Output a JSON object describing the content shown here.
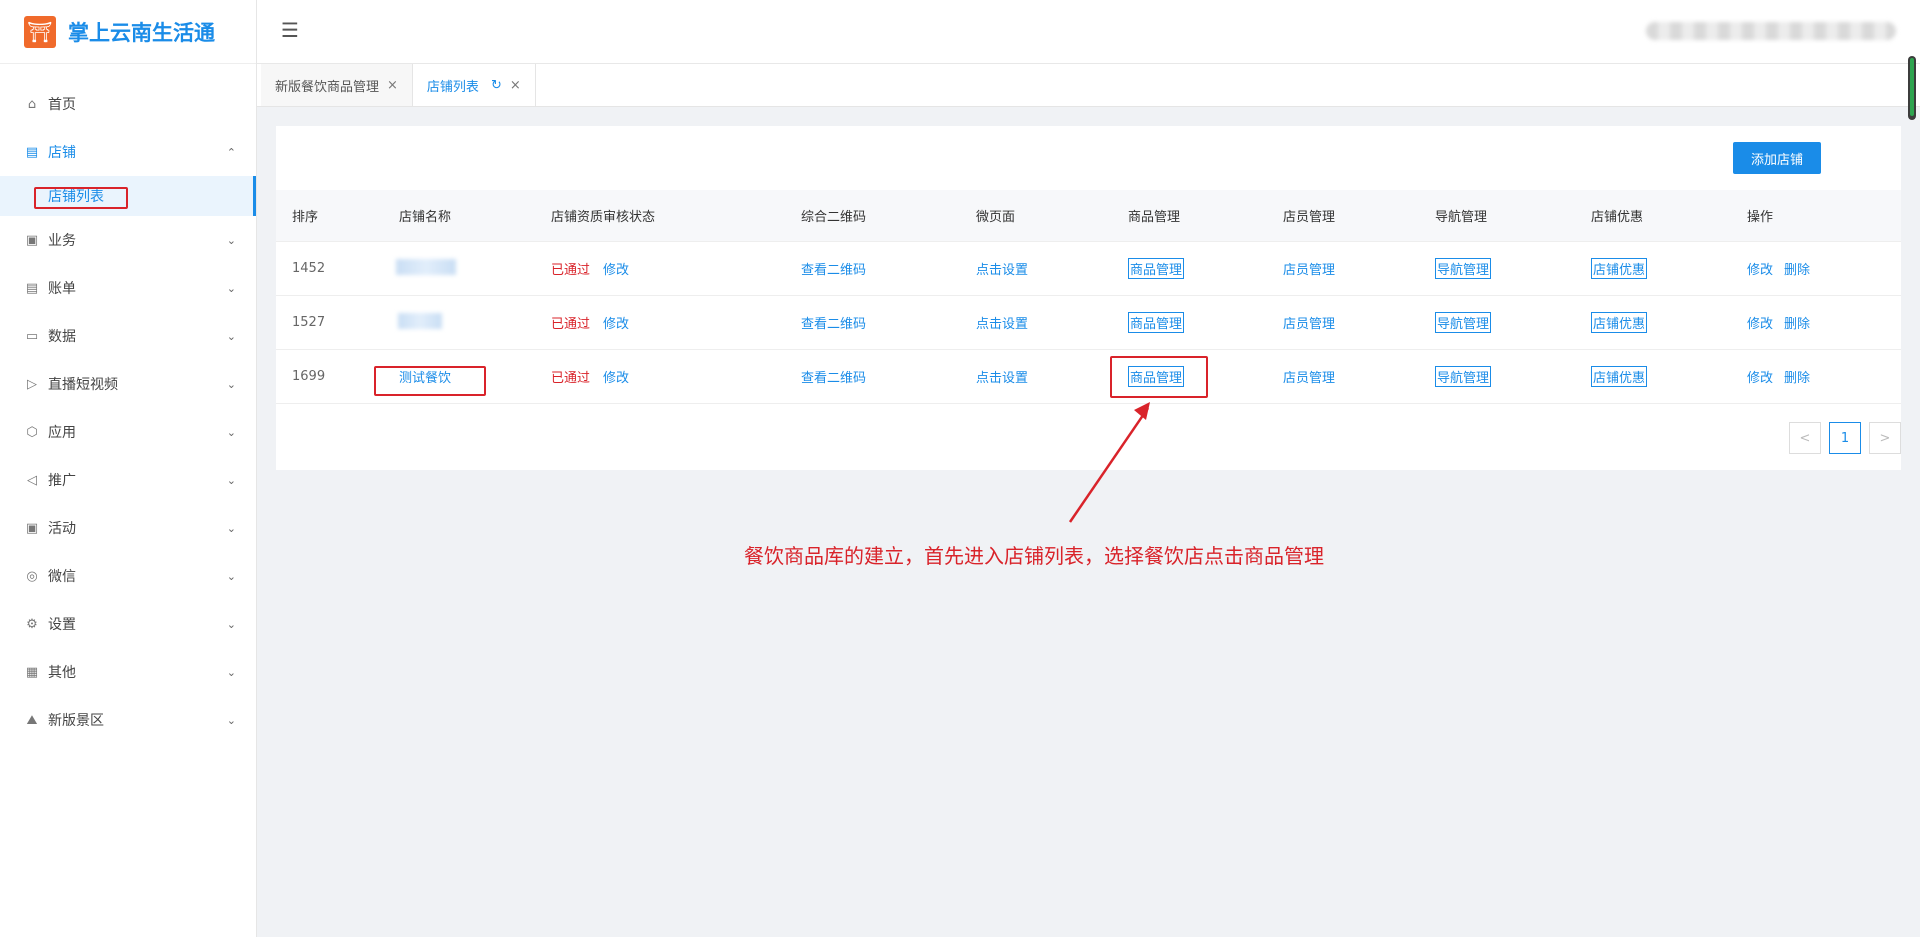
{
  "app": {
    "title": "掌上云南生活通",
    "logo_glyph": "⛩"
  },
  "sidebar": {
    "items": [
      {
        "label": "首页",
        "icon": "home-icon",
        "glyph": "⌂",
        "arrow": ""
      },
      {
        "label": "店铺",
        "icon": "store-icon",
        "glyph": "▤",
        "arrow": "⌃",
        "open": true
      },
      {
        "label": "业务",
        "icon": "business-icon",
        "glyph": "▣",
        "arrow": "⌄"
      },
      {
        "label": "账单",
        "icon": "bill-icon",
        "glyph": "▤",
        "arrow": "⌄"
      },
      {
        "label": "数据",
        "icon": "data-icon",
        "glyph": "▭",
        "arrow": "⌄"
      },
      {
        "label": "直播短视频",
        "icon": "video-icon",
        "glyph": "▷",
        "arrow": "⌄"
      },
      {
        "label": "应用",
        "icon": "app-icon",
        "glyph": "⬡",
        "arrow": "⌄"
      },
      {
        "label": "推广",
        "icon": "megaphone-icon",
        "glyph": "◁",
        "arrow": "⌄"
      },
      {
        "label": "活动",
        "icon": "activity-icon",
        "glyph": "▣",
        "arrow": "⌄"
      },
      {
        "label": "微信",
        "icon": "wechat-icon",
        "glyph": "◎",
        "arrow": "⌄"
      },
      {
        "label": "设置",
        "icon": "settings-icon",
        "glyph": "⚙",
        "arrow": "⌄"
      },
      {
        "label": "其他",
        "icon": "grid-icon",
        "glyph": "▦",
        "arrow": "⌄"
      },
      {
        "label": "新版景区",
        "icon": "scenic-icon",
        "glyph": "⛰",
        "arrow": "⌄"
      }
    ],
    "sub_active": "店铺列表"
  },
  "header": {
    "collapse_glyph": "☰"
  },
  "tabs": [
    {
      "label": "新版餐饮商品管理",
      "close": "×"
    },
    {
      "label": "店铺列表",
      "refresh": "↻",
      "close": "×"
    }
  ],
  "toolbar": {
    "add_label": "添加店铺"
  },
  "table": {
    "headers": [
      "排序",
      "店铺名称",
      "店铺资质审核状态",
      "综合二维码",
      "微页面",
      "商品管理",
      "店员管理",
      "导航管理",
      "店铺优惠",
      "操作"
    ],
    "rows": [
      {
        "sort": "1452",
        "name": "",
        "status": "已通过",
        "edit": "修改",
        "qrcode": "查看二维码",
        "page": "点击设置",
        "goods": "商品管理",
        "staff": "店员管理",
        "nav": "导航管理",
        "discount": "店铺优惠",
        "op_edit": "修改",
        "op_delete": "删除"
      },
      {
        "sort": "1527",
        "name": "",
        "status": "已通过",
        "edit": "修改",
        "qrcode": "查看二维码",
        "page": "点击设置",
        "goods": "商品管理",
        "staff": "店员管理",
        "nav": "导航管理",
        "discount": "店铺优惠",
        "op_edit": "修改",
        "op_delete": "删除"
      },
      {
        "sort": "1699",
        "name": "测试餐饮",
        "status": "已通过",
        "edit": "修改",
        "qrcode": "查看二维码",
        "page": "点击设置",
        "goods": "商品管理",
        "staff": "店员管理",
        "nav": "导航管理",
        "discount": "店铺优惠",
        "op_edit": "修改",
        "op_delete": "删除"
      }
    ]
  },
  "pagination": {
    "prev": "<",
    "current": "1",
    "next": ">"
  },
  "annotation": {
    "text": "餐饮商品库的建立，首先进入店铺列表，选择餐饮店点击商品管理"
  },
  "colors": {
    "accent": "#1a8ce8",
    "annotation": "#d9232a",
    "logo": "#f06a2b"
  }
}
